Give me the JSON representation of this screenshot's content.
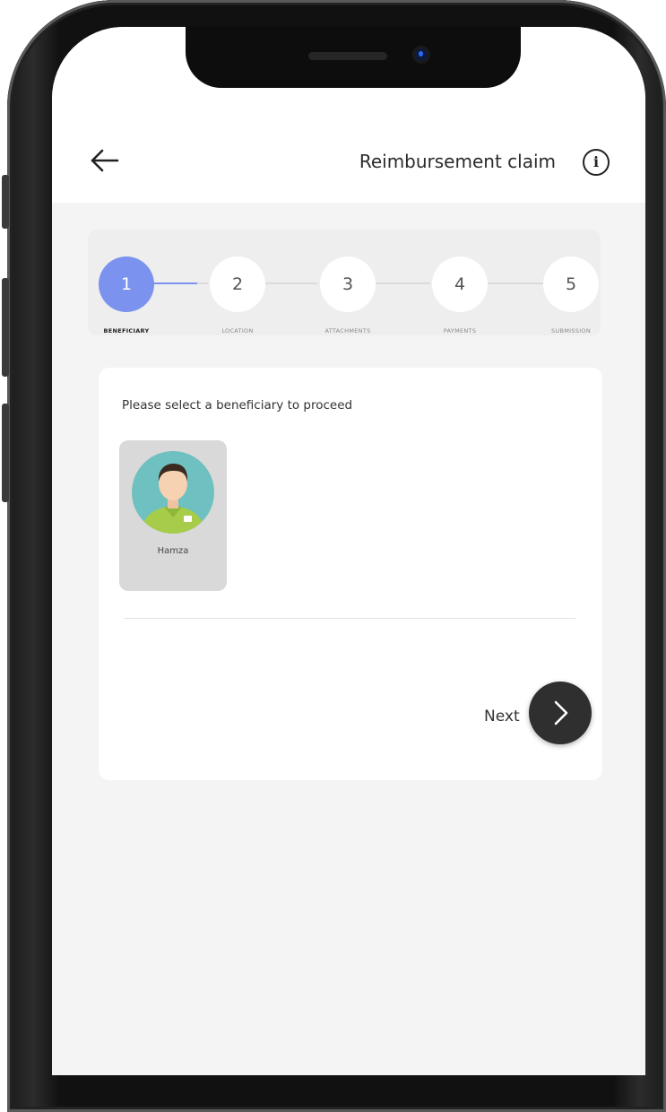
{
  "header": {
    "title": "Reimbursement claim"
  },
  "steps": [
    {
      "number": "1",
      "label": "BENEFICIARY",
      "active": true
    },
    {
      "number": "2",
      "label": "LOCATION"
    },
    {
      "number": "3",
      "label": "ATTACHMENTS"
    },
    {
      "number": "4",
      "label": "PAYMENTS"
    },
    {
      "number": "5",
      "label": "SUBMISSION"
    }
  ],
  "main": {
    "prompt": "Please select a beneficiary to proceed",
    "beneficiary": {
      "name": "Hamza"
    },
    "next_label": "Next"
  },
  "icons": {
    "back": "arrow-left-icon",
    "info": "info-icon",
    "next": "chevron-right-icon"
  },
  "colors": {
    "accent": "#7b93ee",
    "next_button": "#2f2f2f",
    "background": "#f4f4f4"
  }
}
